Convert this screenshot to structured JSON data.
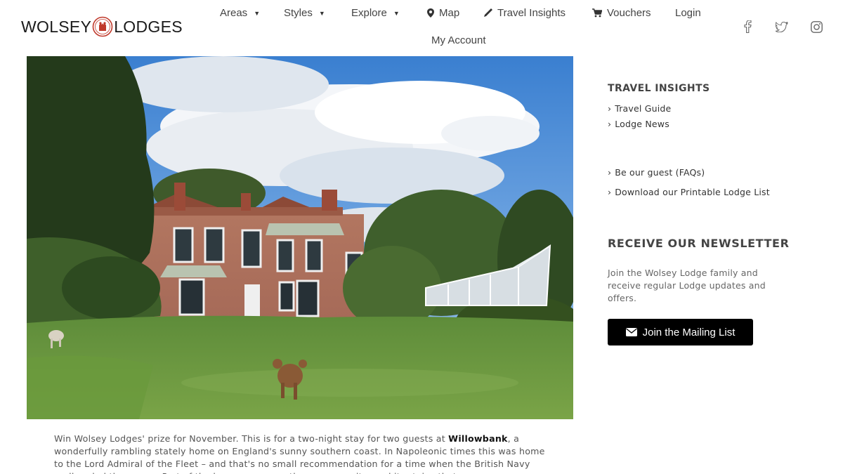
{
  "logo": {
    "text_left": "WOLSEY",
    "text_right": "LODGES",
    "icon": "wolsey-crest-icon"
  },
  "nav": {
    "items": [
      {
        "label": "Areas",
        "has_caret": true
      },
      {
        "label": "Styles",
        "has_caret": true
      },
      {
        "label": "Explore",
        "has_caret": true
      },
      {
        "label": "Map",
        "icon": "map-pin-icon"
      },
      {
        "label": "Travel Insights",
        "icon": "pen-icon"
      },
      {
        "label": "Vouchers",
        "icon": "cart-icon"
      },
      {
        "label": "Login"
      }
    ],
    "second_row": {
      "label": "My Account"
    }
  },
  "social": [
    "facebook-icon",
    "twitter-icon",
    "instagram-icon"
  ],
  "hero": {
    "alt_icon": "country-house-photo"
  },
  "article": {
    "lead": "Win Wolsey Lodges' prize for November. This is for a two-night stay for two guests at ",
    "highlight": "Willowbank",
    "rest": ", a wonderfully rambling stately home on England's sunny southern coast. In Napoleonic times this was home to the Lord Admiral of the Fleet – and that's no small recommendation for a time when the British Navy really ruled the waves. Part of the house was once the nursery suite, and it retains that same"
  },
  "sidebar": {
    "travel_heading": "TRAVEL INSIGHTS",
    "links_top": [
      "Travel Guide",
      "Lodge News"
    ],
    "links_bottom": [
      "Be our guest (FAQs)",
      "Download our Printable Lodge List"
    ],
    "chevron": "›",
    "newsletter_heading": "RECEIVE OUR NEWSLETTER",
    "newsletter_text": "Join the Wolsey Lodge family and receive regular Lodge updates and offers.",
    "button_label": "Join the Mailing List",
    "button_icon": "envelope-icon"
  },
  "colors": {
    "button_bg": "#000000",
    "text": "#333333",
    "heading": "#444444"
  }
}
